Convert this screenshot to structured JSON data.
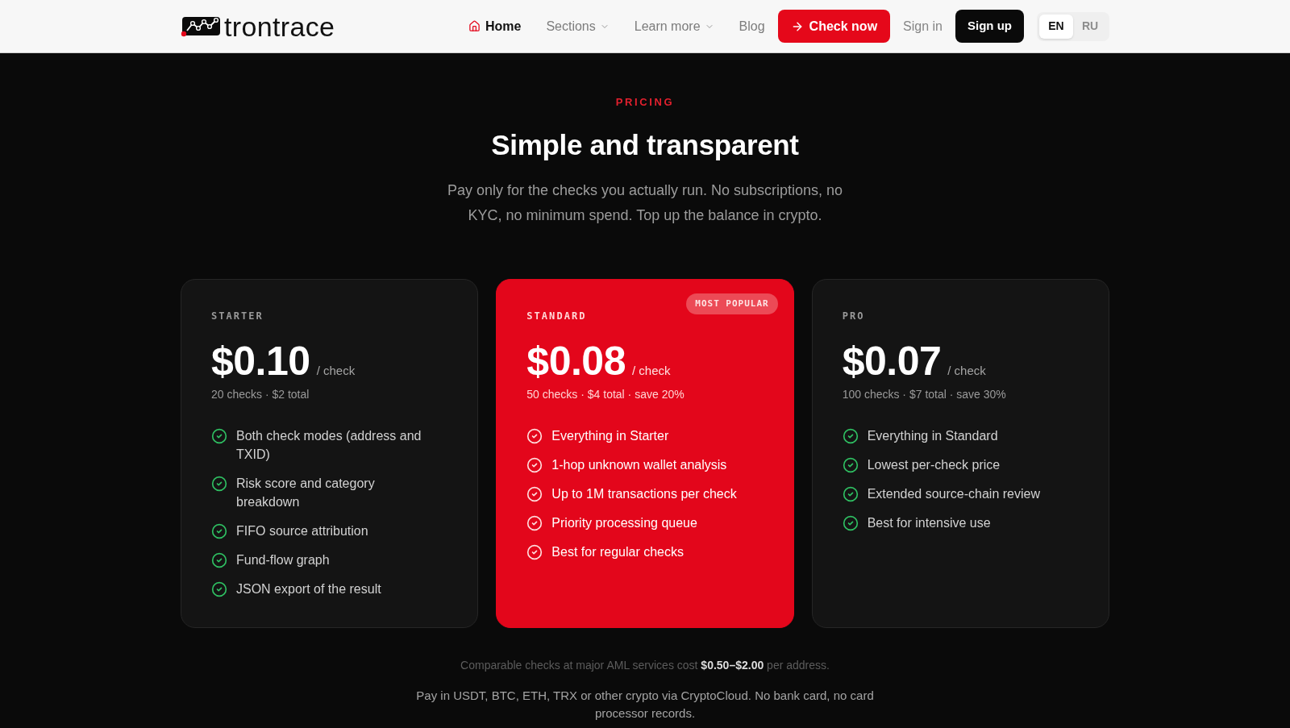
{
  "header": {
    "logo": {
      "text": "trontrace"
    },
    "nav": [
      {
        "label": "Home",
        "kind": "home",
        "selected": true
      },
      {
        "label": "Sections",
        "kind": "dropdown",
        "selected": false
      },
      {
        "label": "Learn more",
        "kind": "dropdown",
        "selected": false
      },
      {
        "label": "Blog",
        "kind": "link",
        "selected": false
      }
    ],
    "actions": [
      {
        "label": "Check now",
        "kind": "primary"
      },
      {
        "label": "Sign in",
        "kind": "link"
      },
      {
        "label": "Sign up",
        "kind": "solid"
      }
    ],
    "languages": [
      {
        "label": "EN",
        "selected": true
      },
      {
        "label": "RU",
        "selected": false
      }
    ]
  },
  "pricing": {
    "eyebrow": "PRICING",
    "title": "Simple and transparent",
    "subtitle": "Pay only for the checks you actually run. No subscriptions, no KYC, no minimum spend. Top up the balance in crypto.",
    "plans": [
      {
        "name": "STARTER",
        "featured": false,
        "price": "$0.10",
        "unit": "/ check",
        "summary": "20 checks · $2 total",
        "features": [
          "Both check modes (address and TXID)",
          "Risk score and category breakdown",
          "FIFO source attribution",
          "Fund-flow graph",
          "JSON export of the result"
        ]
      },
      {
        "name": "STANDARD",
        "featured": true,
        "badge": "MOST POPULAR",
        "price": "$0.08",
        "unit": "/ check",
        "summary": "50 checks · $4 total · save 20%",
        "features": [
          "Everything in Starter",
          "1-hop unknown wallet analysis",
          "Up to 1M transactions per check",
          "Priority processing queue",
          "Best for regular checks"
        ]
      },
      {
        "name": "PRO",
        "featured": false,
        "price": "$0.07",
        "unit": "/ check",
        "summary": "100 checks · $7 total · save 30%",
        "features": [
          "Everything in Standard",
          "Lowest per-check price",
          "Extended source-chain review",
          "Best for intensive use"
        ]
      }
    ],
    "notes": [
      "Comparable checks at major AML services cost **$0.50–$2.00** per address.",
      "Pay in USDT, BTC, ETH, TRX or other crypto via CryptoCloud. No bank card, no card processor records."
    ]
  }
}
